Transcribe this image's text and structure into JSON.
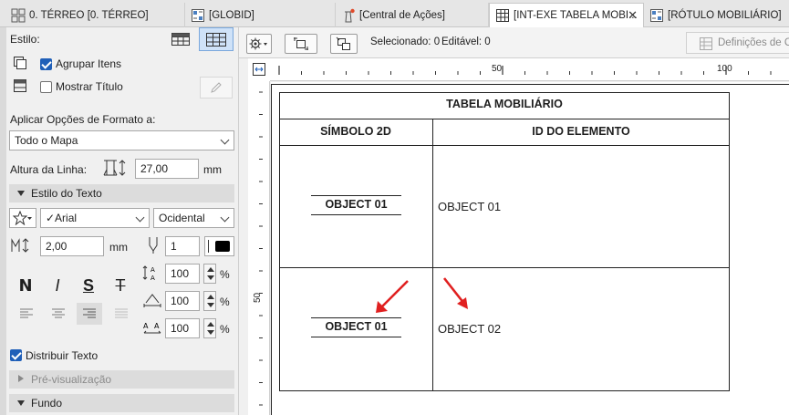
{
  "tabs": [
    {
      "label": "0. TÉRREO [0. TÉRREO]",
      "icon": "floor-plan-icon"
    },
    {
      "label": "[GLOBID]",
      "icon": "schedule-icon"
    },
    {
      "label": "[Central de Ações]",
      "icon": "action-center-icon"
    },
    {
      "label": "[INT-EXE TABELA MOBI...",
      "icon": "table-icon",
      "close": "✕"
    },
    {
      "label": "[RÓTULO MOBILIÁRIO]",
      "icon": "schedule-icon"
    }
  ],
  "panel": {
    "style_label": "Estilo:",
    "group_items_label": "Agrupar Itens",
    "group_items_checked": true,
    "show_title_label": "Mostrar Título",
    "show_title_checked": false,
    "apply_format_label": "Aplicar Opções de Formato a:",
    "apply_format_value": "Todo o Mapa",
    "row_height_label": "Altura da Linha:",
    "row_height_value": "27,00",
    "row_height_unit": "mm",
    "text_style_section": "Estilo do Texto",
    "font_value": "✓Arial",
    "script_value": "Ocidental",
    "text_size_value": "2,00",
    "text_size_unit": "mm",
    "pen_value": "1",
    "pct_unit": "%",
    "line_spacing_value": "100",
    "char_width_value": "100",
    "char_spacing_value": "100",
    "format_bold": "N",
    "format_italic": "I",
    "format_underline": "S",
    "format_strike": "T",
    "wrap_text_label": "Distribuir Texto",
    "wrap_text_checked": true,
    "preview_section": "Pré-visualização",
    "background_section": "Fundo"
  },
  "toolbar": {
    "selected_label": "Selecionado: 0",
    "editable_label": "Editável: 0",
    "definitions_label": "Definições de C"
  },
  "ruler": {
    "top_marks": [
      "50",
      "100"
    ],
    "left_mark": "50"
  },
  "table": {
    "title": "TABELA MOBILIÁRIO",
    "headers": [
      "SÍMBOLO 2D",
      "ID DO ELEMENTO"
    ],
    "rows": [
      {
        "symbol": "OBJECT 01",
        "id": "OBJECT 01"
      },
      {
        "symbol": "OBJECT 01",
        "id": "OBJECT 02"
      }
    ]
  },
  "colors": {
    "accent": "#1f5fb8",
    "annotation_arrow": "#e02020",
    "table_line": "#222222"
  }
}
